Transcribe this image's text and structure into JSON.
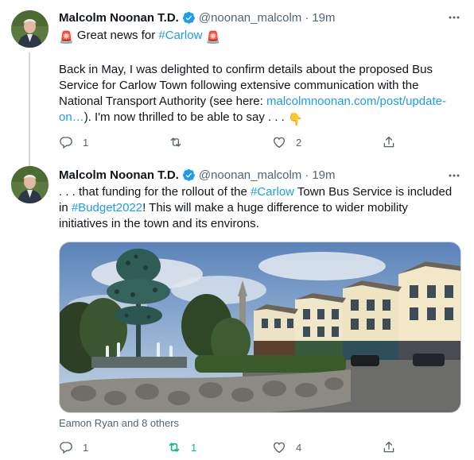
{
  "tweets": [
    {
      "author": {
        "name": "Malcolm Noonan T.D.",
        "handle": "@noonan_malcolm",
        "separator": "·",
        "time": "19m"
      },
      "line1": {
        "emoji_left": "🚨",
        "text": " Great news for ",
        "hashtag": "#Carlow",
        "emoji_right": "🚨"
      },
      "line2": "Back in May, I was delighted to confirm details about the proposed Bus",
      "line3": "Service for Carlow Town following extensive communication with the",
      "line4": {
        "text": "National Transport Authority (see here: ",
        "link": "malcolmnoonan.com/post/update-"
      },
      "line5": {
        "link": "on…",
        "text": "). I'm now thrilled to be able to say . . . ",
        "emoji": "👇"
      },
      "actions": {
        "reply_count": "1",
        "retweet_count": "",
        "like_count": "2"
      }
    },
    {
      "author": {
        "name": "Malcolm Noonan T.D.",
        "handle": "@noonan_malcolm",
        "separator": "·",
        "time": "19m"
      },
      "line1": {
        "text_a": ". . . that funding for the rollout of the ",
        "hashtag": "#Carlow",
        "text_b": " Town Bus Service is included"
      },
      "line2": {
        "text_a": "in ",
        "hashtag": "#Budget2022",
        "text_b": "! This will make a huge difference to wider mobility"
      },
      "line3": "initiatives in the town and its environs.",
      "tagged": "Eamon Ryan and 8 others",
      "actions": {
        "reply_count": "1",
        "retweet_count": "1",
        "like_count": "4"
      }
    }
  ],
  "colors": {
    "link": "#1d9bf0",
    "muted": "#536471",
    "retweet_active": "#00ba7c",
    "verified": "#1d9bf0"
  },
  "icons": [
    "verified-badge-icon",
    "more-icon",
    "reply-icon",
    "retweet-icon",
    "like-icon",
    "share-icon"
  ]
}
